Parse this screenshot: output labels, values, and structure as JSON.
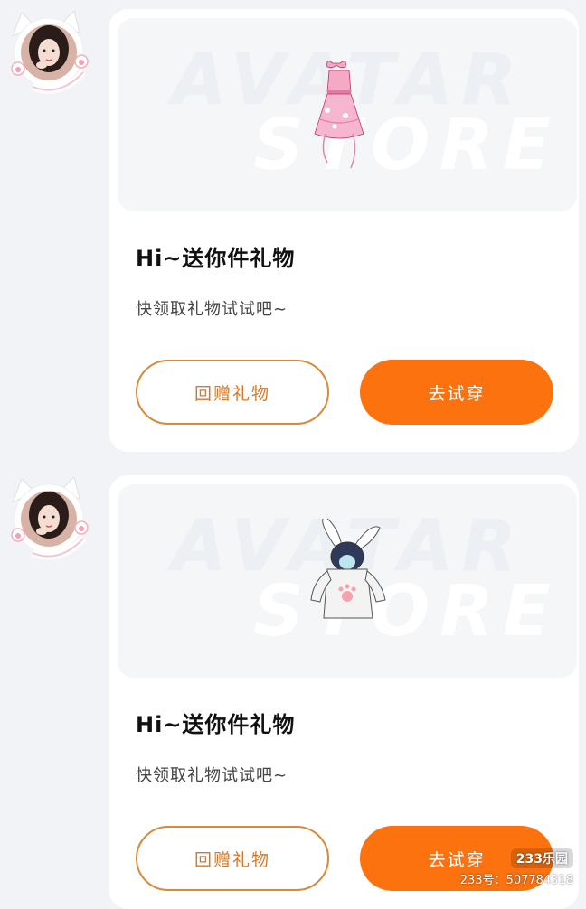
{
  "messages": [
    {
      "card": {
        "watermark_line1": "AVATAR",
        "watermark_line2": "STORE",
        "title": "Hi~送你件礼物",
        "subtitle": "快领取礼物试试吧~",
        "buttons": {
          "return_gift": "回赠礼物",
          "try_on": "去试穿"
        },
        "gift_icon": "pink-dress-icon"
      }
    },
    {
      "card": {
        "watermark_line1": "AVATAR",
        "watermark_line2": "STORE",
        "title": "Hi~送你件礼物",
        "subtitle": "快领取礼物试试吧~",
        "buttons": {
          "return_gift": "回赠礼物",
          "try_on": "去试穿"
        },
        "gift_icon": "bunny-hoodie-icon"
      }
    }
  ],
  "corner_badge": {
    "logo": "233乐园",
    "id_text": "233号：507784318"
  },
  "colors": {
    "accent_orange": "#fb720f",
    "outline_orange": "#d58a3c",
    "page_bg": "#f1f3f6"
  }
}
